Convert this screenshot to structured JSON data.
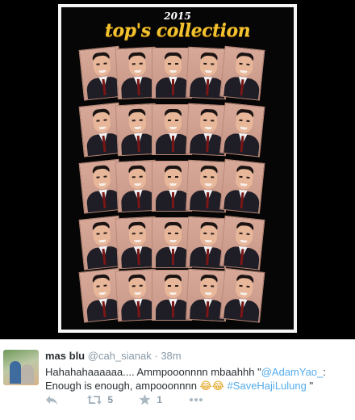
{
  "poster": {
    "year": "2015",
    "title": "top's collection"
  },
  "tweet": {
    "name": "mas blu",
    "handle": "@cah_sianak",
    "separator": "·",
    "time": "38m",
    "text_part1": "Hahahahaaaaaa.... Ammpooonnnn mbaahhh \"",
    "mention": "@AdamYao_",
    "text_part2": ": Enough is enough, ampooonnnn ",
    "emoji": "😂😂",
    "hashtag": "#SaveHajiLulung",
    "text_part3": " \"",
    "retweet_count": "5",
    "favorite_count": "1"
  },
  "icons": {
    "reply": "reply-icon",
    "retweet": "retweet-icon",
    "favorite": "star-icon",
    "more": "more-icon"
  },
  "colors": {
    "link": "#55acee",
    "muted": "#8899a6",
    "poster_title": "#f3c230"
  }
}
